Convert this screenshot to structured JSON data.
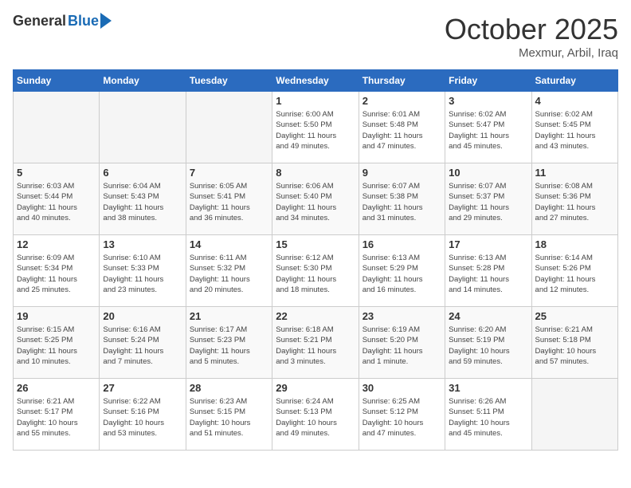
{
  "logo": {
    "general": "General",
    "blue": "Blue"
  },
  "title": "October 2025",
  "location": "Mexmur, Arbil, Iraq",
  "days_of_week": [
    "Sunday",
    "Monday",
    "Tuesday",
    "Wednesday",
    "Thursday",
    "Friday",
    "Saturday"
  ],
  "weeks": [
    [
      {
        "day": "",
        "info": ""
      },
      {
        "day": "",
        "info": ""
      },
      {
        "day": "",
        "info": ""
      },
      {
        "day": "1",
        "info": "Sunrise: 6:00 AM\nSunset: 5:50 PM\nDaylight: 11 hours\nand 49 minutes."
      },
      {
        "day": "2",
        "info": "Sunrise: 6:01 AM\nSunset: 5:48 PM\nDaylight: 11 hours\nand 47 minutes."
      },
      {
        "day": "3",
        "info": "Sunrise: 6:02 AM\nSunset: 5:47 PM\nDaylight: 11 hours\nand 45 minutes."
      },
      {
        "day": "4",
        "info": "Sunrise: 6:02 AM\nSunset: 5:45 PM\nDaylight: 11 hours\nand 43 minutes."
      }
    ],
    [
      {
        "day": "5",
        "info": "Sunrise: 6:03 AM\nSunset: 5:44 PM\nDaylight: 11 hours\nand 40 minutes."
      },
      {
        "day": "6",
        "info": "Sunrise: 6:04 AM\nSunset: 5:43 PM\nDaylight: 11 hours\nand 38 minutes."
      },
      {
        "day": "7",
        "info": "Sunrise: 6:05 AM\nSunset: 5:41 PM\nDaylight: 11 hours\nand 36 minutes."
      },
      {
        "day": "8",
        "info": "Sunrise: 6:06 AM\nSunset: 5:40 PM\nDaylight: 11 hours\nand 34 minutes."
      },
      {
        "day": "9",
        "info": "Sunrise: 6:07 AM\nSunset: 5:38 PM\nDaylight: 11 hours\nand 31 minutes."
      },
      {
        "day": "10",
        "info": "Sunrise: 6:07 AM\nSunset: 5:37 PM\nDaylight: 11 hours\nand 29 minutes."
      },
      {
        "day": "11",
        "info": "Sunrise: 6:08 AM\nSunset: 5:36 PM\nDaylight: 11 hours\nand 27 minutes."
      }
    ],
    [
      {
        "day": "12",
        "info": "Sunrise: 6:09 AM\nSunset: 5:34 PM\nDaylight: 11 hours\nand 25 minutes."
      },
      {
        "day": "13",
        "info": "Sunrise: 6:10 AM\nSunset: 5:33 PM\nDaylight: 11 hours\nand 23 minutes."
      },
      {
        "day": "14",
        "info": "Sunrise: 6:11 AM\nSunset: 5:32 PM\nDaylight: 11 hours\nand 20 minutes."
      },
      {
        "day": "15",
        "info": "Sunrise: 6:12 AM\nSunset: 5:30 PM\nDaylight: 11 hours\nand 18 minutes."
      },
      {
        "day": "16",
        "info": "Sunrise: 6:13 AM\nSunset: 5:29 PM\nDaylight: 11 hours\nand 16 minutes."
      },
      {
        "day": "17",
        "info": "Sunrise: 6:13 AM\nSunset: 5:28 PM\nDaylight: 11 hours\nand 14 minutes."
      },
      {
        "day": "18",
        "info": "Sunrise: 6:14 AM\nSunset: 5:26 PM\nDaylight: 11 hours\nand 12 minutes."
      }
    ],
    [
      {
        "day": "19",
        "info": "Sunrise: 6:15 AM\nSunset: 5:25 PM\nDaylight: 11 hours\nand 10 minutes."
      },
      {
        "day": "20",
        "info": "Sunrise: 6:16 AM\nSunset: 5:24 PM\nDaylight: 11 hours\nand 7 minutes."
      },
      {
        "day": "21",
        "info": "Sunrise: 6:17 AM\nSunset: 5:23 PM\nDaylight: 11 hours\nand 5 minutes."
      },
      {
        "day": "22",
        "info": "Sunrise: 6:18 AM\nSunset: 5:21 PM\nDaylight: 11 hours\nand 3 minutes."
      },
      {
        "day": "23",
        "info": "Sunrise: 6:19 AM\nSunset: 5:20 PM\nDaylight: 11 hours\nand 1 minute."
      },
      {
        "day": "24",
        "info": "Sunrise: 6:20 AM\nSunset: 5:19 PM\nDaylight: 10 hours\nand 59 minutes."
      },
      {
        "day": "25",
        "info": "Sunrise: 6:21 AM\nSunset: 5:18 PM\nDaylight: 10 hours\nand 57 minutes."
      }
    ],
    [
      {
        "day": "26",
        "info": "Sunrise: 6:21 AM\nSunset: 5:17 PM\nDaylight: 10 hours\nand 55 minutes."
      },
      {
        "day": "27",
        "info": "Sunrise: 6:22 AM\nSunset: 5:16 PM\nDaylight: 10 hours\nand 53 minutes."
      },
      {
        "day": "28",
        "info": "Sunrise: 6:23 AM\nSunset: 5:15 PM\nDaylight: 10 hours\nand 51 minutes."
      },
      {
        "day": "29",
        "info": "Sunrise: 6:24 AM\nSunset: 5:13 PM\nDaylight: 10 hours\nand 49 minutes."
      },
      {
        "day": "30",
        "info": "Sunrise: 6:25 AM\nSunset: 5:12 PM\nDaylight: 10 hours\nand 47 minutes."
      },
      {
        "day": "31",
        "info": "Sunrise: 6:26 AM\nSunset: 5:11 PM\nDaylight: 10 hours\nand 45 minutes."
      },
      {
        "day": "",
        "info": ""
      }
    ]
  ]
}
